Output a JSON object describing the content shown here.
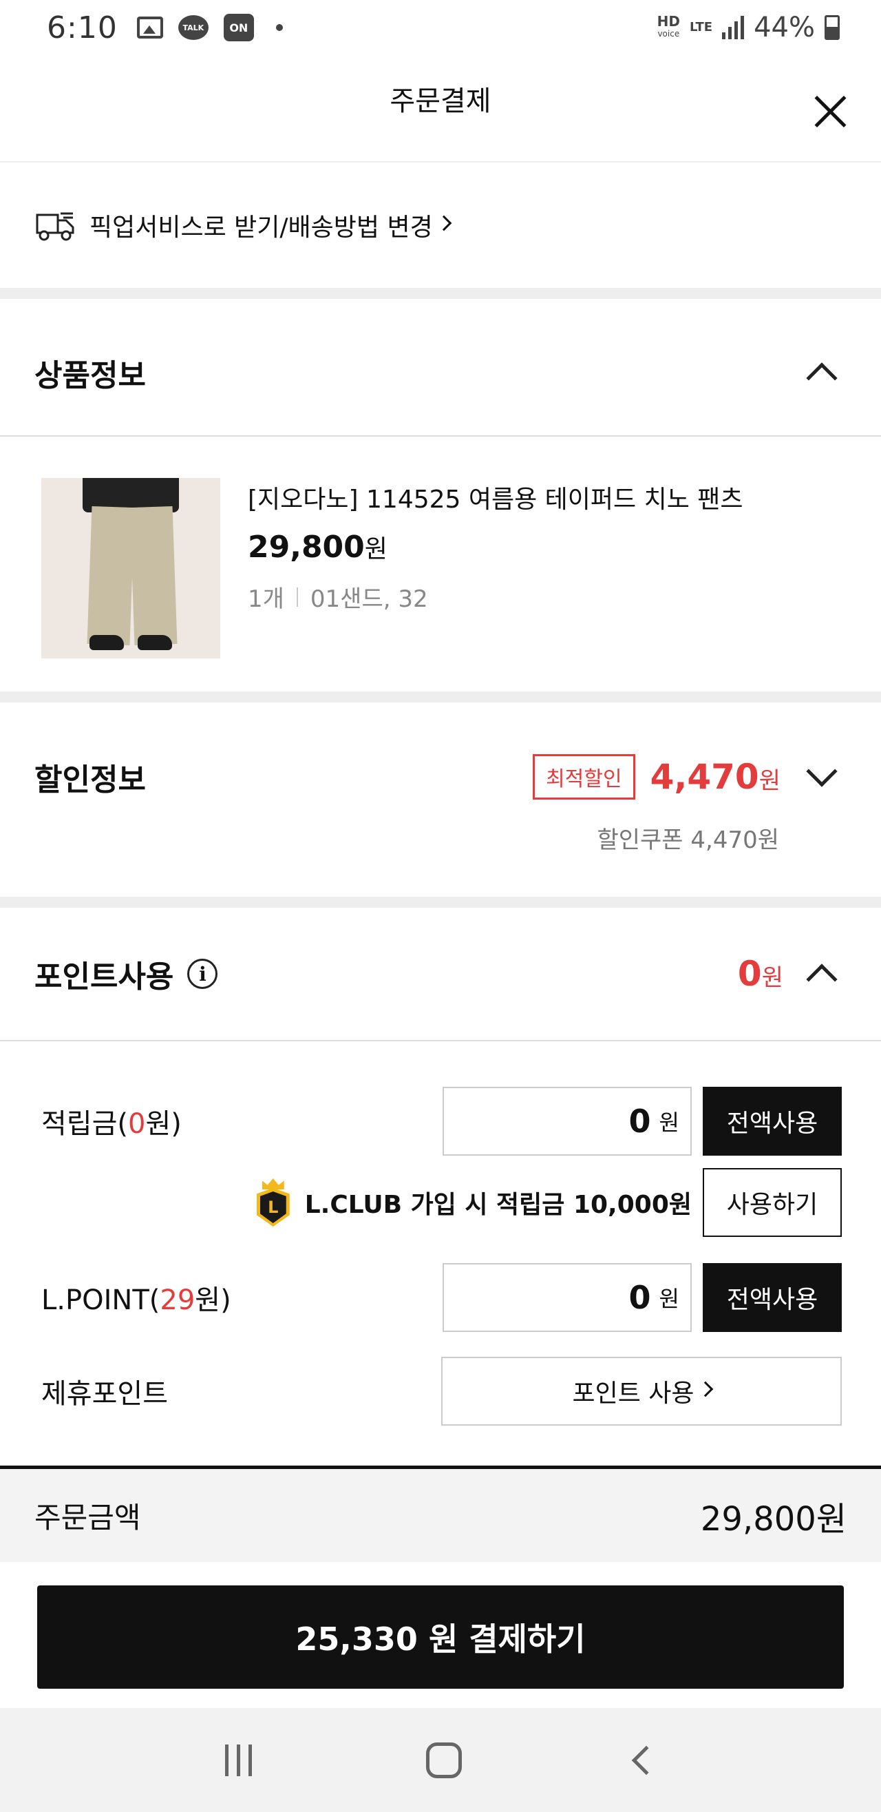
{
  "status_bar": {
    "time": "6:10",
    "talk_label": "TALK",
    "on_label": "ON",
    "hd_label": "HD",
    "voice_label": "voice",
    "lte_label": "LTE",
    "battery": "44%"
  },
  "header": {
    "title": "주문결제",
    "close_icon": "close-icon"
  },
  "pickup": {
    "label": "픽업서비스로 받기/배송방법 변경",
    "icon": "delivery-truck-icon"
  },
  "product_section": {
    "title": "상품정보",
    "item": {
      "name": "[지오다노] 114525 여름용 테이퍼드 치노 팬츠",
      "price": "29,800",
      "currency": "원",
      "quantity": "1개",
      "option": "01샌드, 32"
    }
  },
  "discount_section": {
    "title": "할인정보",
    "badge": "최적할인",
    "amount": "4,470",
    "currency": "원",
    "detail": "할인쿠폰 4,470원"
  },
  "points_section": {
    "title": "포인트사용",
    "amount": "0",
    "currency": "원",
    "reserve": {
      "label_prefix": "적립금(",
      "label_value": "0",
      "label_suffix": "원)",
      "input_value": "0",
      "unit": "원",
      "button": "전액사용"
    },
    "lclub": {
      "badge_letter": "L",
      "text": "L.CLUB 가입 시 적립금 10,000원",
      "button": "사용하기"
    },
    "lpoint": {
      "label_prefix": "L.POINT(",
      "label_value": "29",
      "label_suffix": "원)",
      "input_value": "0",
      "unit": "원",
      "button": "전액사용"
    },
    "partner": {
      "label": "제휴포인트",
      "button": "포인트 사용"
    }
  },
  "summary": {
    "label": "주문금액",
    "value": "29,800원"
  },
  "cta": {
    "label": "25,330 원 결제하기"
  },
  "colors": {
    "accent_red": "#e23c3c",
    "primary_black": "#111111",
    "lclub_gold": "#f3b91a"
  }
}
